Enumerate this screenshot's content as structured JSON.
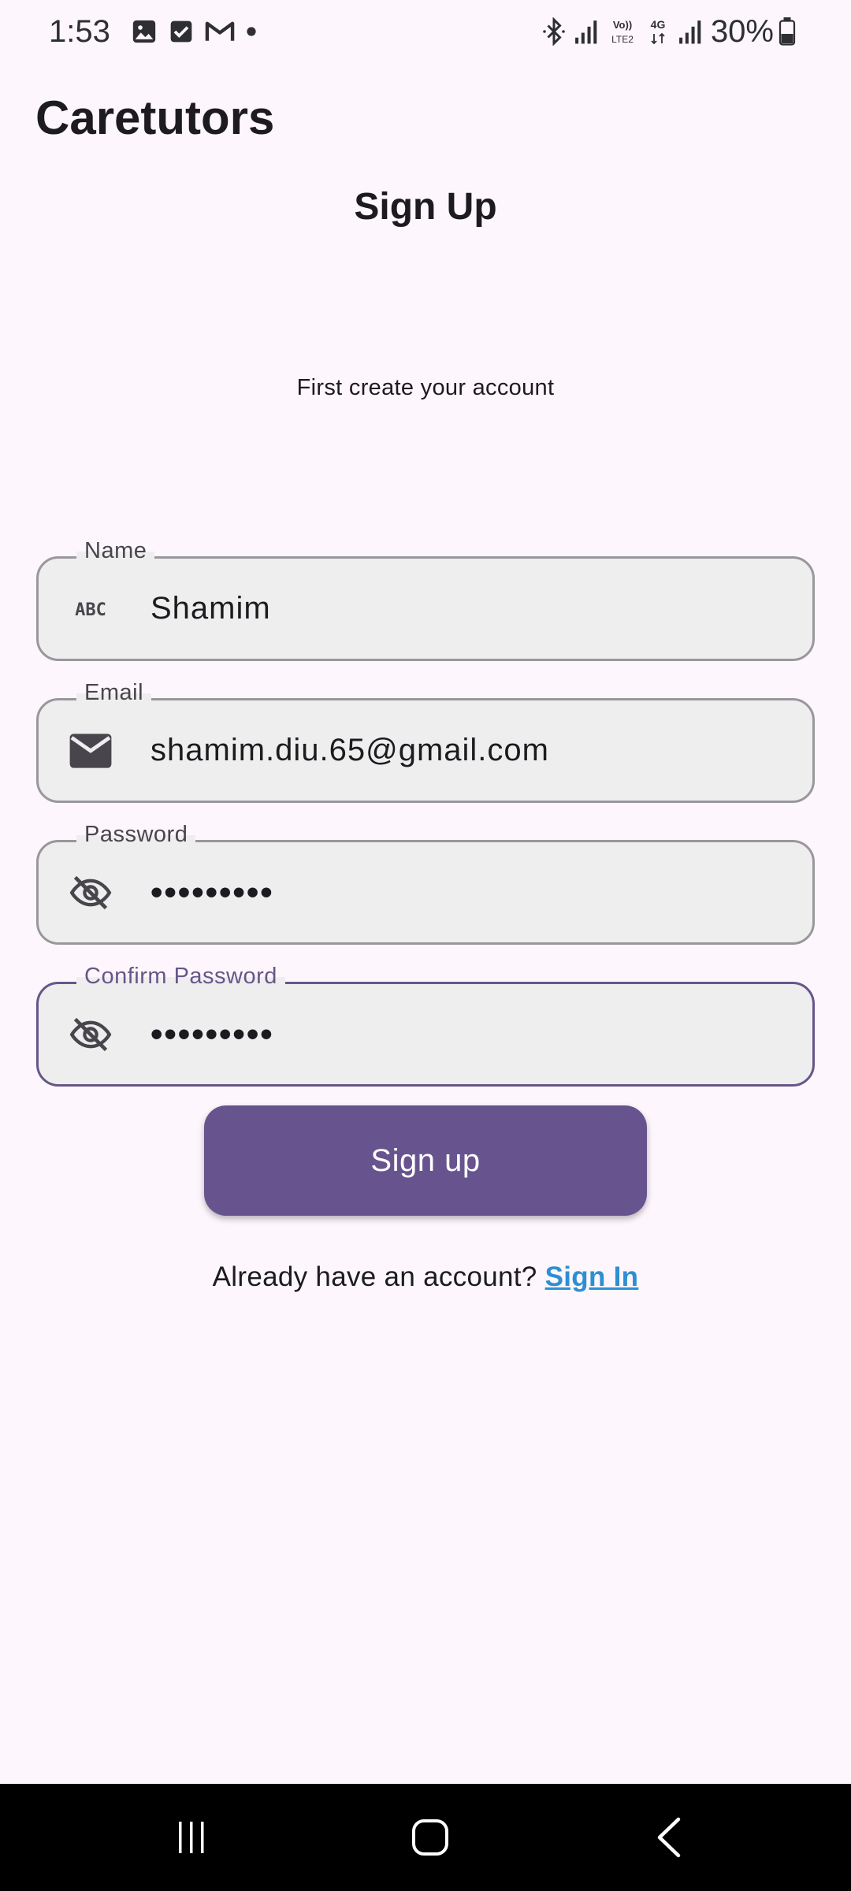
{
  "status_bar": {
    "time": "1:53",
    "battery": "30%",
    "icons": [
      "image-icon",
      "checkbox-icon",
      "gmail-icon",
      "dot-icon",
      "bluetooth-icon",
      "signal-icon",
      "volte-icon",
      "4g-icon",
      "signal-icon",
      "battery-icon"
    ],
    "volte_label": "Vo)) LTE2",
    "network_label": "4G"
  },
  "app": {
    "title": "Caretutors"
  },
  "page": {
    "title": "Sign Up",
    "subtitle": "First create your account"
  },
  "form": {
    "name": {
      "label": "Name",
      "value": "Shamim",
      "icon": "abc-icon"
    },
    "email": {
      "label": "Email",
      "value": "shamim.diu.65@gmail.com",
      "icon": "mail-icon"
    },
    "password": {
      "label": "Password",
      "value": "•••••••••",
      "icon": "visibility-off-icon"
    },
    "confirm_password": {
      "label": "Confirm Password",
      "value": "•••••••••",
      "icon": "visibility-off-icon"
    }
  },
  "actions": {
    "signup_label": "Sign up",
    "signin_prompt": "Already have an account?",
    "signin_link": "Sign In"
  },
  "colors": {
    "background": "#fdf7fd",
    "primary": "#67548e",
    "link": "#2d8fd3",
    "field_fill": "#eeeeee",
    "focused_border": "#675689"
  },
  "nav_bar": {
    "buttons": [
      "recent-apps-icon",
      "home-icon",
      "back-icon"
    ]
  }
}
